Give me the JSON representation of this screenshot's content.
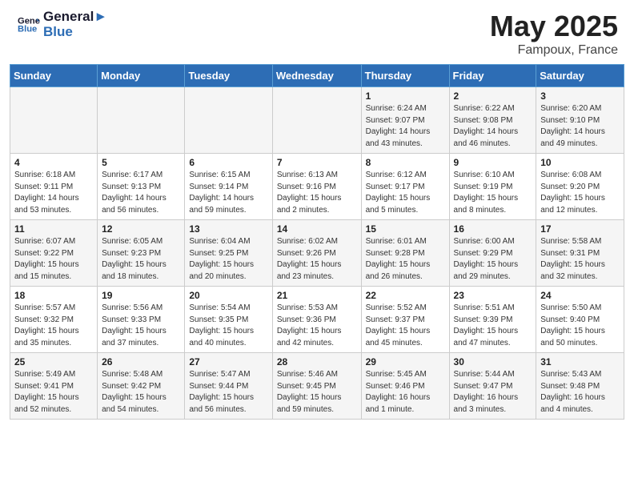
{
  "header": {
    "logo_line1": "General",
    "logo_line2": "Blue",
    "title": "May 2025",
    "subtitle": "Fampoux, France"
  },
  "days_of_week": [
    "Sunday",
    "Monday",
    "Tuesday",
    "Wednesday",
    "Thursday",
    "Friday",
    "Saturday"
  ],
  "weeks": [
    [
      {
        "day": "",
        "info": ""
      },
      {
        "day": "",
        "info": ""
      },
      {
        "day": "",
        "info": ""
      },
      {
        "day": "",
        "info": ""
      },
      {
        "day": "1",
        "info": "Sunrise: 6:24 AM\nSunset: 9:07 PM\nDaylight: 14 hours and 43 minutes."
      },
      {
        "day": "2",
        "info": "Sunrise: 6:22 AM\nSunset: 9:08 PM\nDaylight: 14 hours and 46 minutes."
      },
      {
        "day": "3",
        "info": "Sunrise: 6:20 AM\nSunset: 9:10 PM\nDaylight: 14 hours and 49 minutes."
      }
    ],
    [
      {
        "day": "4",
        "info": "Sunrise: 6:18 AM\nSunset: 9:11 PM\nDaylight: 14 hours and 53 minutes."
      },
      {
        "day": "5",
        "info": "Sunrise: 6:17 AM\nSunset: 9:13 PM\nDaylight: 14 hours and 56 minutes."
      },
      {
        "day": "6",
        "info": "Sunrise: 6:15 AM\nSunset: 9:14 PM\nDaylight: 14 hours and 59 minutes."
      },
      {
        "day": "7",
        "info": "Sunrise: 6:13 AM\nSunset: 9:16 PM\nDaylight: 15 hours and 2 minutes."
      },
      {
        "day": "8",
        "info": "Sunrise: 6:12 AM\nSunset: 9:17 PM\nDaylight: 15 hours and 5 minutes."
      },
      {
        "day": "9",
        "info": "Sunrise: 6:10 AM\nSunset: 9:19 PM\nDaylight: 15 hours and 8 minutes."
      },
      {
        "day": "10",
        "info": "Sunrise: 6:08 AM\nSunset: 9:20 PM\nDaylight: 15 hours and 12 minutes."
      }
    ],
    [
      {
        "day": "11",
        "info": "Sunrise: 6:07 AM\nSunset: 9:22 PM\nDaylight: 15 hours and 15 minutes."
      },
      {
        "day": "12",
        "info": "Sunrise: 6:05 AM\nSunset: 9:23 PM\nDaylight: 15 hours and 18 minutes."
      },
      {
        "day": "13",
        "info": "Sunrise: 6:04 AM\nSunset: 9:25 PM\nDaylight: 15 hours and 20 minutes."
      },
      {
        "day": "14",
        "info": "Sunrise: 6:02 AM\nSunset: 9:26 PM\nDaylight: 15 hours and 23 minutes."
      },
      {
        "day": "15",
        "info": "Sunrise: 6:01 AM\nSunset: 9:28 PM\nDaylight: 15 hours and 26 minutes."
      },
      {
        "day": "16",
        "info": "Sunrise: 6:00 AM\nSunset: 9:29 PM\nDaylight: 15 hours and 29 minutes."
      },
      {
        "day": "17",
        "info": "Sunrise: 5:58 AM\nSunset: 9:31 PM\nDaylight: 15 hours and 32 minutes."
      }
    ],
    [
      {
        "day": "18",
        "info": "Sunrise: 5:57 AM\nSunset: 9:32 PM\nDaylight: 15 hours and 35 minutes."
      },
      {
        "day": "19",
        "info": "Sunrise: 5:56 AM\nSunset: 9:33 PM\nDaylight: 15 hours and 37 minutes."
      },
      {
        "day": "20",
        "info": "Sunrise: 5:54 AM\nSunset: 9:35 PM\nDaylight: 15 hours and 40 minutes."
      },
      {
        "day": "21",
        "info": "Sunrise: 5:53 AM\nSunset: 9:36 PM\nDaylight: 15 hours and 42 minutes."
      },
      {
        "day": "22",
        "info": "Sunrise: 5:52 AM\nSunset: 9:37 PM\nDaylight: 15 hours and 45 minutes."
      },
      {
        "day": "23",
        "info": "Sunrise: 5:51 AM\nSunset: 9:39 PM\nDaylight: 15 hours and 47 minutes."
      },
      {
        "day": "24",
        "info": "Sunrise: 5:50 AM\nSunset: 9:40 PM\nDaylight: 15 hours and 50 minutes."
      }
    ],
    [
      {
        "day": "25",
        "info": "Sunrise: 5:49 AM\nSunset: 9:41 PM\nDaylight: 15 hours and 52 minutes."
      },
      {
        "day": "26",
        "info": "Sunrise: 5:48 AM\nSunset: 9:42 PM\nDaylight: 15 hours and 54 minutes."
      },
      {
        "day": "27",
        "info": "Sunrise: 5:47 AM\nSunset: 9:44 PM\nDaylight: 15 hours and 56 minutes."
      },
      {
        "day": "28",
        "info": "Sunrise: 5:46 AM\nSunset: 9:45 PM\nDaylight: 15 hours and 59 minutes."
      },
      {
        "day": "29",
        "info": "Sunrise: 5:45 AM\nSunset: 9:46 PM\nDaylight: 16 hours and 1 minute."
      },
      {
        "day": "30",
        "info": "Sunrise: 5:44 AM\nSunset: 9:47 PM\nDaylight: 16 hours and 3 minutes."
      },
      {
        "day": "31",
        "info": "Sunrise: 5:43 AM\nSunset: 9:48 PM\nDaylight: 16 hours and 4 minutes."
      }
    ]
  ]
}
